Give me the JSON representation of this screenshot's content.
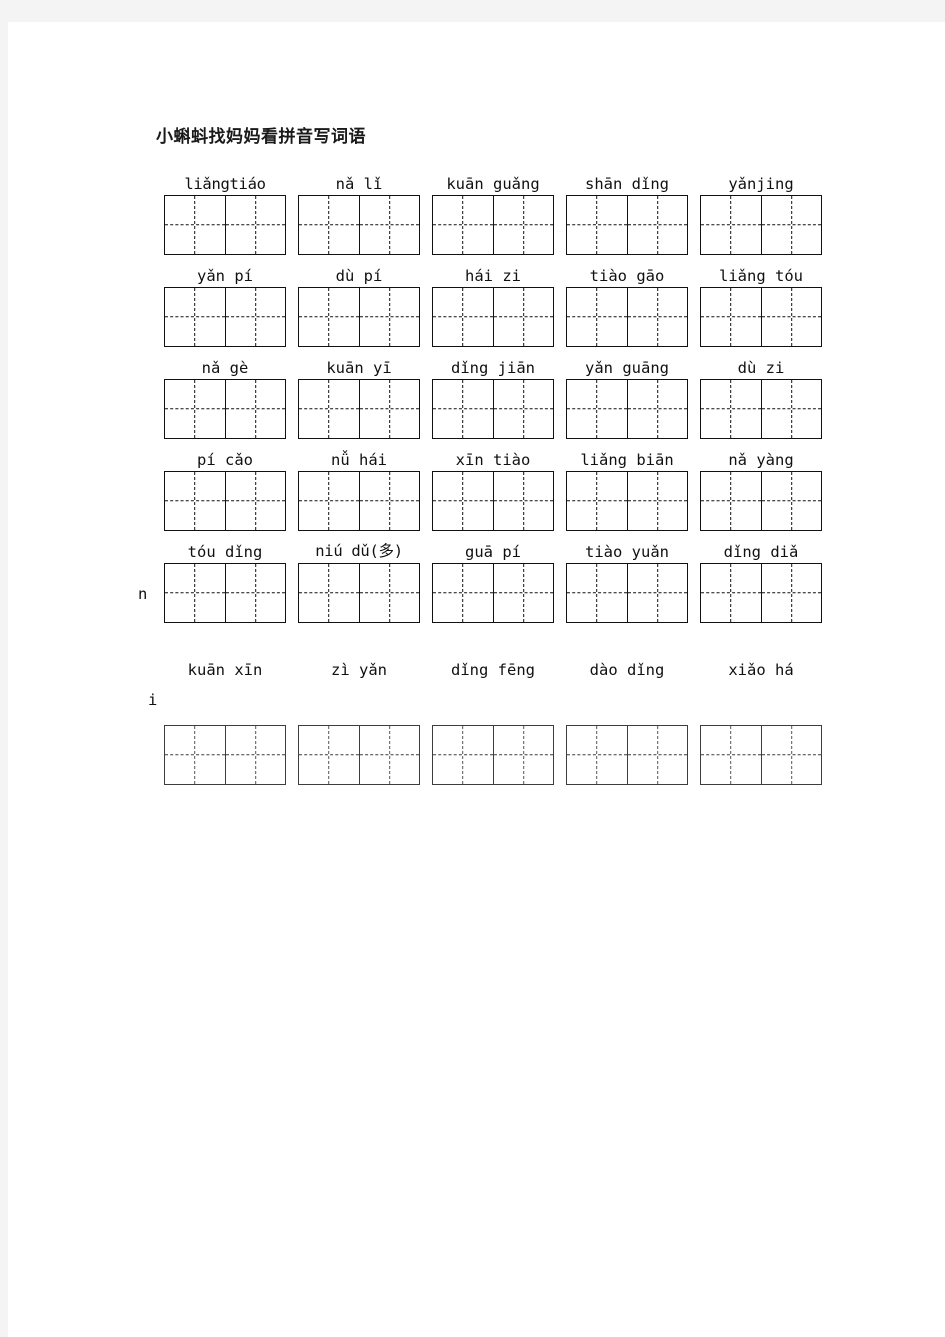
{
  "document": {
    "title": "小蝌蚪找妈妈看拼音写词语",
    "page_background": "#ffffff",
    "margin_background": "#f4f4f4",
    "text_color": "#111111"
  },
  "worksheet": {
    "grid_type": "tian-zi-ge",
    "cells_per_box": 2,
    "boxes_per_row": 5,
    "rows": [
      {
        "labels": [
          "liǎngtiáo",
          "nǎ lǐ",
          "kuān guǎng",
          "shān dǐng",
          "yǎnjing"
        ],
        "wrap_fragment": ""
      },
      {
        "labels": [
          "yǎn  pí",
          "dù  pí",
          "hái zi",
          "tiào gāo",
          "liǎng tóu"
        ],
        "wrap_fragment": ""
      },
      {
        "labels": [
          "nǎ gè",
          "kuān yī",
          "dǐng jiān",
          "yǎn guāng",
          "dù zi"
        ],
        "wrap_fragment": ""
      },
      {
        "labels": [
          "pí cǎo",
          "nǚ hái",
          "xīn tiào",
          "liǎng biān",
          "nǎ yàng"
        ],
        "wrap_fragment": ""
      },
      {
        "labels": [
          "tóu dǐng",
          "niú dǔ(多)",
          "guā pí",
          "tiào yuǎn",
          "dǐng diǎ"
        ],
        "wrap_fragment": "n"
      },
      {
        "labels": [
          "kuān xīn",
          "zì yǎn",
          "dǐng fēng",
          "dào dǐng",
          "xiǎo há"
        ],
        "wrap_fragment": "i"
      }
    ]
  }
}
